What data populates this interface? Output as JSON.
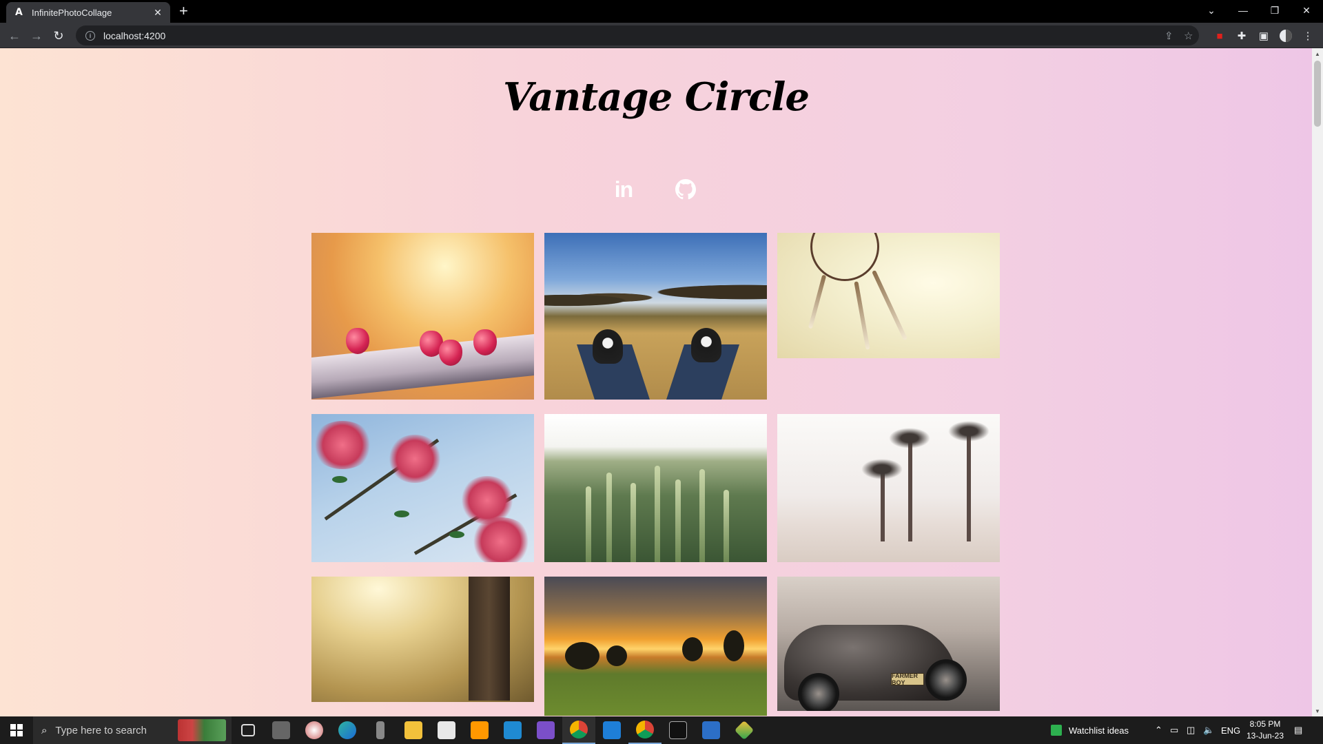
{
  "browser": {
    "tab_title": "InfinitePhotoCollage",
    "tab_favicon": "A",
    "url": "localhost:4200",
    "new_tab_icon": "plus-icon",
    "window_controls": [
      "tab-search-icon",
      "minimize-icon",
      "restore-icon",
      "close-icon"
    ]
  },
  "page": {
    "title": "Vantage Circle",
    "social_links": [
      {
        "icon": "linkedin-icon",
        "label": "in"
      },
      {
        "icon": "github-icon",
        "label": ""
      }
    ],
    "photos": [
      {
        "subject": "raspberries-on-ledge"
      },
      {
        "subject": "sneakers-on-field"
      },
      {
        "subject": "dreamcatcher"
      },
      {
        "subject": "pink-flowers-sky"
      },
      {
        "subject": "wheat-field"
      },
      {
        "subject": "palm-trees-beach"
      },
      {
        "subject": "sunlit-meadow-post"
      },
      {
        "subject": "sunset-trees-field"
      },
      {
        "subject": "vintage-car"
      }
    ],
    "car_plate_text": "FARMER BOY",
    "background_colors": [
      "#fde3d3",
      "#f3cfe2",
      "#eec6e6"
    ]
  },
  "taskbar": {
    "search_placeholder": "Type here to search",
    "widget_label": "Watchlist ideas",
    "language": "ENG",
    "time": "8:05 PM",
    "date": "13-Jun-23",
    "pinned_apps": [
      "task-view",
      "snipping-tool",
      "paint",
      "edge",
      "usb-device",
      "file-explorer",
      "store",
      "sublime-text",
      "vscode",
      "visual-studio",
      "chrome",
      "mail",
      "chrome-profile",
      "terminal",
      "photos",
      "git"
    ]
  }
}
